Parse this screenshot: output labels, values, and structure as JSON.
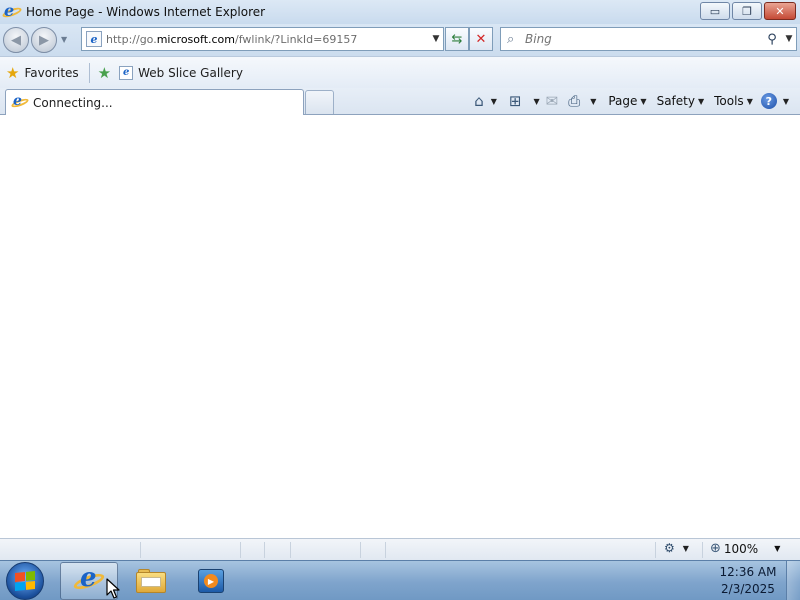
{
  "window": {
    "title": "Home Page - Windows Internet Explorer",
    "controls": {
      "minimize": "▭",
      "maximize": "❐",
      "close": "✕"
    }
  },
  "nav": {
    "url_host_prefix": "http://go.",
    "url_host": "microsoft.com",
    "url_path": "/fwlink/?LinkId=69157",
    "search_placeholder": "Bing"
  },
  "favorites_bar": {
    "favorites_label": "Favorites",
    "web_slice_label": "Web Slice Gallery"
  },
  "tab": {
    "label": "Connecting..."
  },
  "command_bar": {
    "page_label": "Page",
    "safety_label": "Safety",
    "tools_label": "Tools",
    "help_glyph": "?"
  },
  "status_bar": {
    "zoom": "100%"
  },
  "taskbar": {
    "time": "12:36 AM",
    "date": "2/3/2025"
  },
  "icons": {
    "browser": "ie-icon",
    "search": "magnifier-icon",
    "home": "home-icon",
    "feeds": "rss-icon",
    "mail": "mail-icon",
    "print": "print-icon",
    "help": "help-icon",
    "favorites": "star-icon"
  },
  "colors": {
    "accent": "#1b63c6",
    "chrome": "#d9e6f4",
    "close_button": "#c54a36"
  }
}
